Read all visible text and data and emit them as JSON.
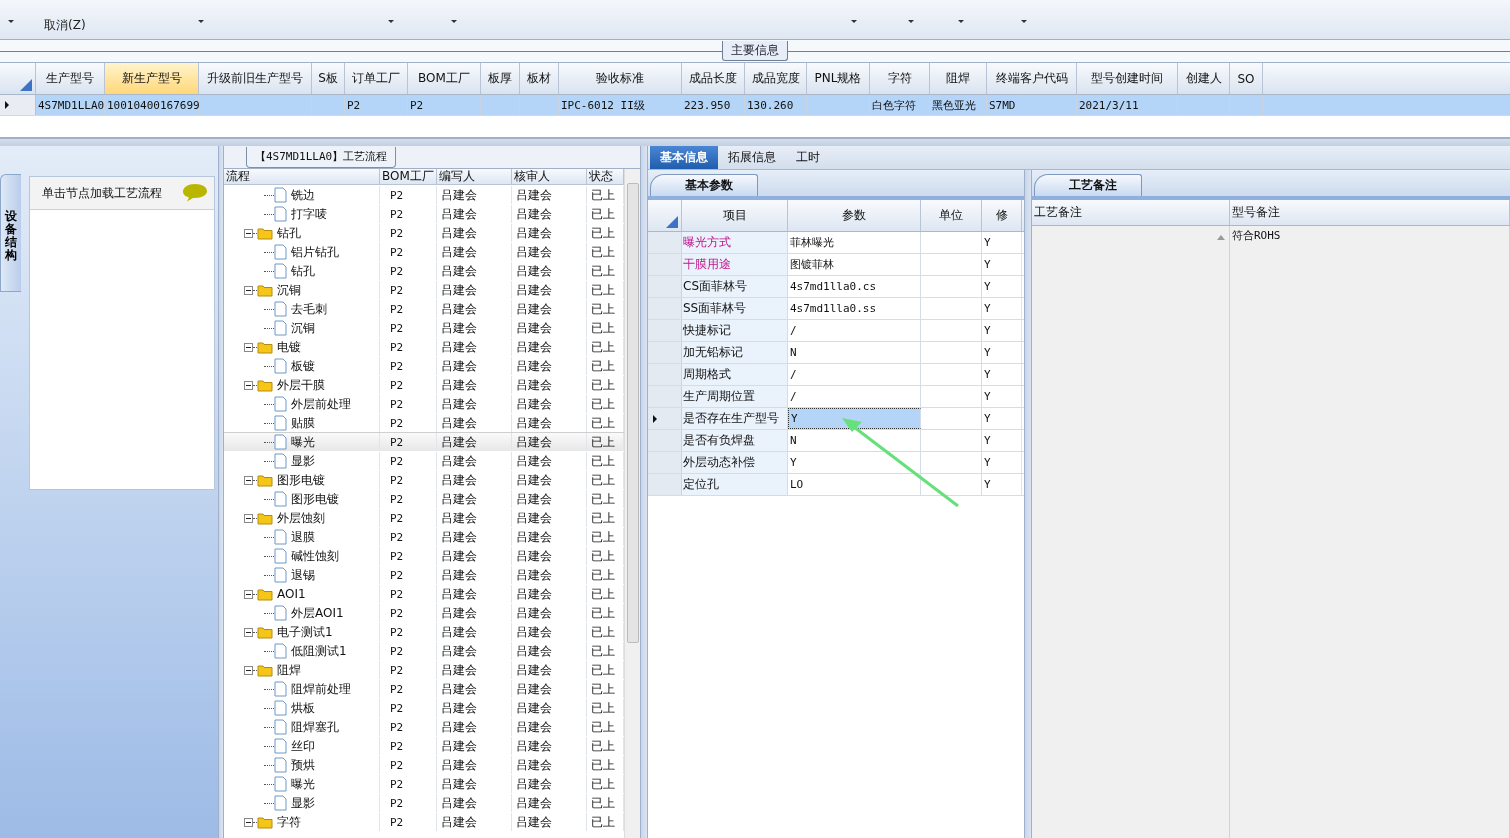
{
  "toolbar": {
    "items": [
      {
        "kind": "caret"
      },
      {
        "kind": "command",
        "label": "取消(Z)"
      },
      {
        "kind": "caret"
      },
      {
        "kind": "caret"
      },
      {
        "kind": "caret"
      },
      {
        "kind": "caret"
      },
      {
        "kind": "caret"
      },
      {
        "kind": "caret"
      },
      {
        "kind": "caret"
      }
    ]
  },
  "main_info": {
    "title": "主要信息",
    "columns": [
      {
        "label": "生产型号",
        "value": "4S7MD1LLA0",
        "selected": false
      },
      {
        "label": "新生产型号",
        "value": "10010400167699",
        "selected": true
      },
      {
        "label": "升级前旧生产型号",
        "selected": false
      },
      {
        "label": "S板",
        "selected": false
      },
      {
        "label": "订单工厂",
        "value": "P2",
        "selected": false
      },
      {
        "label": "BOM工厂",
        "value": "P2",
        "selected": false
      },
      {
        "label": "板厚",
        "selected": false
      },
      {
        "label": "板材",
        "selected": false
      },
      {
        "label": "验收标准",
        "value": "IPC-6012 II级",
        "selected": false
      },
      {
        "label": "成品长度",
        "value": "223.950",
        "selected": false
      },
      {
        "label": "成品宽度",
        "value": "130.260",
        "selected": false
      },
      {
        "label": "PNL规格",
        "selected": false
      },
      {
        "label": "字符",
        "value": "白色字符",
        "selected": false
      },
      {
        "label": "阻焊",
        "value": "黑色亚光",
        "selected": false
      },
      {
        "label": "终端客户代码",
        "value": "S7MD",
        "selected": false
      },
      {
        "label": "型号创建时间",
        "value": "2021/3/11",
        "selected": false
      },
      {
        "label": "创建人",
        "selected": false
      },
      {
        "label": "SO",
        "selected": false
      }
    ],
    "row": {
      "selected": true
    }
  },
  "side_tab": {
    "label": "设备结构",
    "selected": true
  },
  "side_panel": {
    "hint": "单击节点加载工艺流程"
  },
  "flow": {
    "title": "【4S7MD1LLA0】工艺流程",
    "columns": [
      "流程",
      "BOM工厂",
      "编写人",
      "核审人",
      "状态"
    ],
    "nodes": [
      {
        "children": [
          {
            "kind": "step",
            "label": "铣边",
            "cells": [
              "P2",
              "吕建会",
              "吕建会",
              "已上"
            ],
            "selected": false
          },
          {
            "kind": "step",
            "label": "打字唛",
            "cells": [
              "P2",
              "吕建会",
              "吕建会",
              "已上"
            ],
            "selected": false
          }
        ]
      },
      {
        "kind": "folder",
        "label": "钻孔",
        "cells": [
          "P2",
          "吕建会",
          "吕建会",
          "已上"
        ],
        "expanded": true,
        "selected": false,
        "children": [
          {
            "kind": "step",
            "label": "铝片钻孔",
            "cells": [
              "P2",
              "吕建会",
              "吕建会",
              "已上"
            ],
            "selected": false
          },
          {
            "kind": "step",
            "label": "钻孔",
            "cells": [
              "P2",
              "吕建会",
              "吕建会",
              "已上"
            ],
            "selected": false
          }
        ]
      },
      {
        "kind": "folder",
        "label": "沉铜",
        "cells": [
          "P2",
          "吕建会",
          "吕建会",
          "已上"
        ],
        "expanded": true,
        "selected": false,
        "children": [
          {
            "kind": "step",
            "label": "去毛刺",
            "cells": [
              "P2",
              "吕建会",
              "吕建会",
              "已上"
            ],
            "selected": false
          },
          {
            "kind": "step",
            "label": "沉铜",
            "cells": [
              "P2",
              "吕建会",
              "吕建会",
              "已上"
            ],
            "selected": false
          }
        ]
      },
      {
        "kind": "folder",
        "label": "电镀",
        "cells": [
          "P2",
          "吕建会",
          "吕建会",
          "已上"
        ],
        "expanded": true,
        "selected": false,
        "children": [
          {
            "kind": "step",
            "label": "板镀",
            "cells": [
              "P2",
              "吕建会",
              "吕建会",
              "已上"
            ],
            "selected": false
          }
        ]
      },
      {
        "kind": "folder",
        "label": "外层干膜",
        "cells": [
          "P2",
          "吕建会",
          "吕建会",
          "已上"
        ],
        "expanded": true,
        "selected": false,
        "children": [
          {
            "kind": "step",
            "label": "外层前处理",
            "cells": [
              "P2",
              "吕建会",
              "吕建会",
              "已上"
            ],
            "selected": false
          },
          {
            "kind": "step",
            "label": "贴膜",
            "cells": [
              "P2",
              "吕建会",
              "吕建会",
              "已上"
            ],
            "selected": false
          },
          {
            "kind": "step",
            "label": "曝光",
            "cells": [
              "P2",
              "吕建会",
              "吕建会",
              "已上"
            ],
            "selected": true
          },
          {
            "kind": "step",
            "label": "显影",
            "cells": [
              "P2",
              "吕建会",
              "吕建会",
              "已上"
            ],
            "selected": false
          }
        ]
      },
      {
        "kind": "folder",
        "label": "图形电镀",
        "cells": [
          "P2",
          "吕建会",
          "吕建会",
          "已上"
        ],
        "expanded": true,
        "selected": false,
        "children": [
          {
            "kind": "step",
            "label": "图形电镀",
            "cells": [
              "P2",
              "吕建会",
              "吕建会",
              "已上"
            ],
            "selected": false
          }
        ]
      },
      {
        "kind": "folder",
        "label": "外层蚀刻",
        "cells": [
          "P2",
          "吕建会",
          "吕建会",
          "已上"
        ],
        "expanded": true,
        "selected": false,
        "children": [
          {
            "kind": "step",
            "label": "退膜",
            "cells": [
              "P2",
              "吕建会",
              "吕建会",
              "已上"
            ],
            "selected": false
          },
          {
            "kind": "step",
            "label": "碱性蚀刻",
            "cells": [
              "P2",
              "吕建会",
              "吕建会",
              "已上"
            ],
            "selected": false
          },
          {
            "kind": "step",
            "label": "退锡",
            "cells": [
              "P2",
              "吕建会",
              "吕建会",
              "已上"
            ],
            "selected": false
          }
        ]
      },
      {
        "kind": "folder",
        "label": "AOI1",
        "cells": [
          "P2",
          "吕建会",
          "吕建会",
          "已上"
        ],
        "expanded": true,
        "selected": false,
        "children": [
          {
            "kind": "step",
            "label": "外层AOI1",
            "cells": [
              "P2",
              "吕建会",
              "吕建会",
              "已上"
            ],
            "selected": false
          }
        ]
      },
      {
        "kind": "folder",
        "label": "电子测试1",
        "cells": [
          "P2",
          "吕建会",
          "吕建会",
          "已上"
        ],
        "expanded": true,
        "selected": false,
        "children": [
          {
            "kind": "step",
            "label": "低阻测试1",
            "cells": [
              "P2",
              "吕建会",
              "吕建会",
              "已上"
            ],
            "selected": false
          }
        ]
      },
      {
        "kind": "folder",
        "label": "阻焊",
        "cells": [
          "P2",
          "吕建会",
          "吕建会",
          "已上"
        ],
        "expanded": true,
        "selected": false,
        "children": [
          {
            "kind": "step",
            "label": "阻焊前处理",
            "cells": [
              "P2",
              "吕建会",
              "吕建会",
              "已上"
            ],
            "selected": false
          },
          {
            "kind": "step",
            "label": "烘板",
            "cells": [
              "P2",
              "吕建会",
              "吕建会",
              "已上"
            ],
            "selected": false
          },
          {
            "kind": "step",
            "label": "阻焊塞孔",
            "cells": [
              "P2",
              "吕建会",
              "吕建会",
              "已上"
            ],
            "selected": false
          },
          {
            "kind": "step",
            "label": "丝印",
            "cells": [
              "P2",
              "吕建会",
              "吕建会",
              "已上"
            ],
            "selected": false
          },
          {
            "kind": "step",
            "label": "预烘",
            "cells": [
              "P2",
              "吕建会",
              "吕建会",
              "已上"
            ],
            "selected": false
          },
          {
            "kind": "step",
            "label": "曝光",
            "cells": [
              "P2",
              "吕建会",
              "吕建会",
              "已上"
            ],
            "selected": false
          },
          {
            "kind": "step",
            "label": "显影",
            "cells": [
              "P2",
              "吕建会",
              "吕建会",
              "已上"
            ],
            "selected": false
          }
        ]
      },
      {
        "kind": "folder",
        "label": "字符",
        "cells": [
          "P2",
          "吕建会",
          "吕建会",
          "已上"
        ],
        "expanded": true,
        "selected": false
      }
    ]
  },
  "detail_tabs": [
    {
      "label": "基本信息",
      "selected": true
    },
    {
      "label": "拓展信息",
      "selected": false
    },
    {
      "label": "工时",
      "selected": false
    }
  ],
  "params": {
    "tab": "基本参数",
    "columns": [
      "项目",
      "参数",
      "单位",
      "修"
    ],
    "rows": [
      {
        "item": "曝光方式",
        "value": "菲林曝光",
        "modify": "Y",
        "emphasis": true,
        "selected": false
      },
      {
        "item": "干膜用途",
        "value": "图镀菲林",
        "modify": "Y",
        "emphasis": true,
        "selected": false
      },
      {
        "item": "CS面菲林号",
        "value": "4s7md1lla0.cs",
        "modify": "Y",
        "emphasis": false,
        "selected": false
      },
      {
        "item": "SS面菲林号",
        "value": "4s7md1lla0.ss",
        "modify": "Y",
        "emphasis": false,
        "selected": false
      },
      {
        "item": "快捷标记",
        "value": "/",
        "modify": "Y",
        "emphasis": false,
        "selected": false
      },
      {
        "item": "加无铅标记",
        "value": "N",
        "modify": "Y",
        "emphasis": false,
        "selected": false
      },
      {
        "item": "周期格式",
        "value": "/",
        "modify": "Y",
        "emphasis": false,
        "selected": false
      },
      {
        "item": "生产周期位置",
        "value": "/",
        "modify": "Y",
        "emphasis": false,
        "selected": false
      },
      {
        "item": "是否存在生产型号",
        "value": "Y",
        "modify": "Y",
        "emphasis": false,
        "selected": true
      },
      {
        "item": "是否有负焊盘",
        "value": "N",
        "modify": "Y",
        "emphasis": false,
        "selected": false
      },
      {
        "item": "外层动态补偿",
        "value": "Y",
        "modify": "Y",
        "emphasis": false,
        "selected": false
      },
      {
        "item": "定位孔",
        "value": "LO",
        "modify": "Y",
        "emphasis": false,
        "selected": false
      }
    ]
  },
  "notes": {
    "tab": "工艺备注",
    "columns": [
      "工艺备注",
      "型号备注"
    ],
    "model_note": "符合ROHS"
  }
}
